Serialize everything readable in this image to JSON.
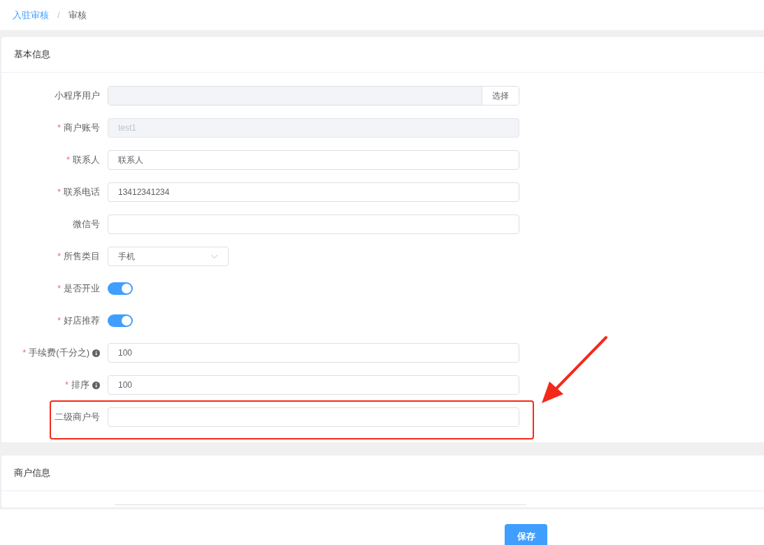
{
  "breadcrumb": [
    {
      "label": "入驻审核",
      "selected": false
    },
    {
      "label": "审核",
      "selected": true
    }
  ],
  "breadcrumb_separator": "/",
  "sections": [
    {
      "title": "基本信息",
      "fields": [
        {
          "kind": "picker",
          "label": "小程序用户",
          "disabled": true,
          "button": "选择"
        },
        {
          "kind": "input",
          "label": "商户账号",
          "asterisk": "*",
          "value": "test1",
          "disabled": true
        },
        {
          "kind": "input",
          "label": "联系人",
          "asterisk": "*",
          "value": "联系人",
          "disabled": false
        },
        {
          "kind": "input",
          "label": "联系电话",
          "asterisk": "*",
          "value": "13412341234",
          "disabled": false
        },
        {
          "kind": "input",
          "label": "微信号",
          "disabled": false
        },
        {
          "kind": "select",
          "label": "所售类目",
          "asterisk": "*",
          "value": "手机"
        },
        {
          "kind": "switch",
          "label": "是否开业",
          "asterisk": "*",
          "on": true
        },
        {
          "kind": "switch",
          "label": "好店推荐",
          "asterisk": "*",
          "on": true
        },
        {
          "kind": "input",
          "label": "手续费(千分之)",
          "asterisk": "*",
          "info": true,
          "value": "100",
          "disabled": false
        },
        {
          "kind": "input",
          "label": "排序",
          "asterisk": "*",
          "info": true,
          "value": "100",
          "disabled": false
        },
        {
          "kind": "input",
          "label": "二级商户号",
          "disabled": false,
          "highlighted": true
        }
      ]
    },
    {
      "title": "商户信息"
    }
  ],
  "save_button": "保存"
}
